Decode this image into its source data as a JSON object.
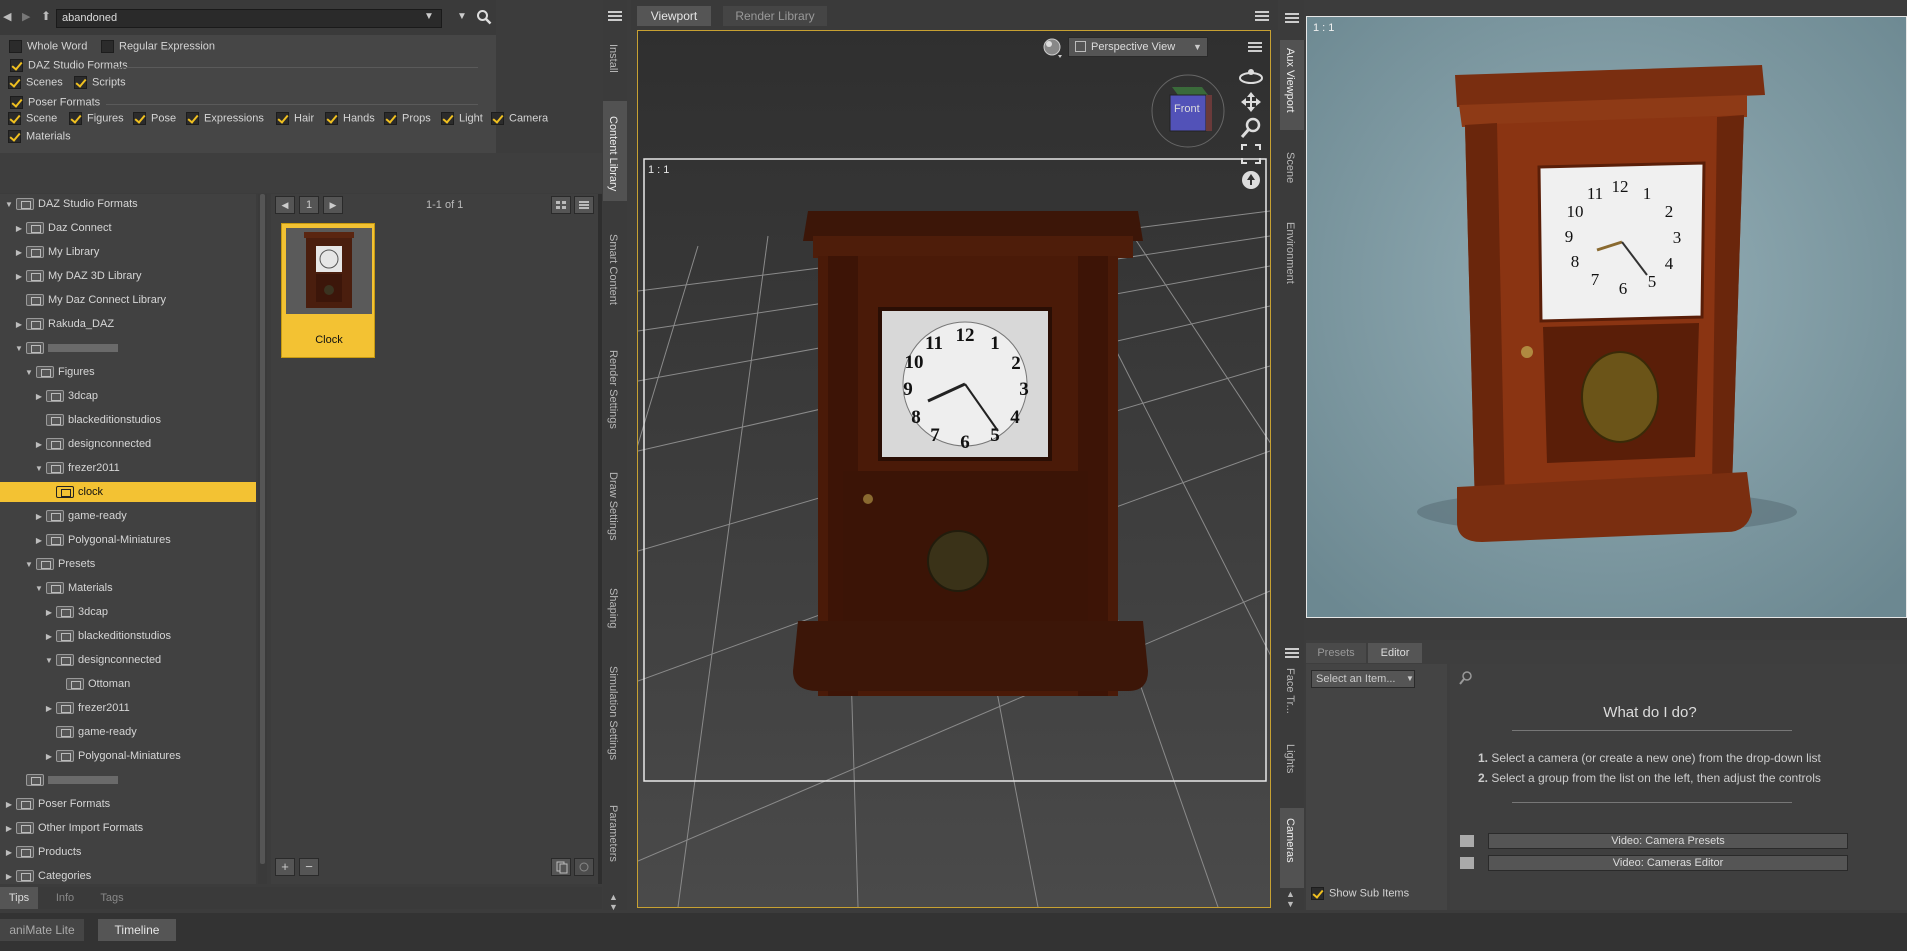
{
  "search": {
    "value": "abandoned"
  },
  "filters": {
    "whole_word": "Whole Word",
    "regex": "Regular Expression",
    "daz_formats": "DAZ Studio Formats",
    "scenes": "Scenes",
    "scripts": "Scripts",
    "poser_formats": "Poser Formats",
    "scene": "Scene",
    "figures": "Figures",
    "pose": "Pose",
    "expressions": "Expressions",
    "hair": "Hair",
    "hands": "Hands",
    "props": "Props",
    "light": "Light",
    "camera": "Camera",
    "materials": "Materials"
  },
  "tree": [
    {
      "label": "DAZ Studio Formats",
      "indent": 0,
      "arrow": "▼",
      "kind": "root"
    },
    {
      "label": "Daz Connect",
      "indent": 1,
      "arrow": "▶",
      "kind": "connect"
    },
    {
      "label": "My Library",
      "indent": 1,
      "arrow": "▶",
      "kind": "folder"
    },
    {
      "label": "My DAZ 3D Library",
      "indent": 1,
      "arrow": "▶",
      "kind": "folder"
    },
    {
      "label": "My Daz Connect Library",
      "indent": 1,
      "arrow": "",
      "kind": "folder"
    },
    {
      "label": "Rakuda_DAZ",
      "indent": 1,
      "arrow": "▶",
      "kind": "folder"
    },
    {
      "label": "",
      "indent": 1,
      "arrow": "▼",
      "kind": "blur"
    },
    {
      "label": "Figures",
      "indent": 2,
      "arrow": "▼",
      "kind": "folder"
    },
    {
      "label": "3dcap",
      "indent": 3,
      "arrow": "▶",
      "kind": "folder"
    },
    {
      "label": "blackeditionstudios",
      "indent": 3,
      "arrow": "",
      "kind": "folder"
    },
    {
      "label": "designconnected",
      "indent": 3,
      "arrow": "▶",
      "kind": "folder"
    },
    {
      "label": "frezer2011",
      "indent": 3,
      "arrow": "▼",
      "kind": "folder"
    },
    {
      "label": "clock",
      "indent": 4,
      "arrow": "",
      "kind": "folder",
      "selected": true
    },
    {
      "label": "game-ready",
      "indent": 3,
      "arrow": "▶",
      "kind": "folder"
    },
    {
      "label": "Polygonal-Miniatures",
      "indent": 3,
      "arrow": "▶",
      "kind": "folder"
    },
    {
      "label": "Presets",
      "indent": 2,
      "arrow": "▼",
      "kind": "folder"
    },
    {
      "label": "Materials",
      "indent": 3,
      "arrow": "▼",
      "kind": "folder"
    },
    {
      "label": "3dcap",
      "indent": 4,
      "arrow": "▶",
      "kind": "folder"
    },
    {
      "label": "blackeditionstudios",
      "indent": 4,
      "arrow": "▶",
      "kind": "folder"
    },
    {
      "label": "designconnected",
      "indent": 4,
      "arrow": "▼",
      "kind": "folder"
    },
    {
      "label": "Ottoman",
      "indent": 5,
      "arrow": "",
      "kind": "folder"
    },
    {
      "label": "frezer2011",
      "indent": 4,
      "arrow": "▶",
      "kind": "folder"
    },
    {
      "label": "game-ready",
      "indent": 4,
      "arrow": "",
      "kind": "folder"
    },
    {
      "label": "Polygonal-Miniatures",
      "indent": 4,
      "arrow": "▶",
      "kind": "folder"
    },
    {
      "label": "",
      "indent": 1,
      "arrow": "",
      "kind": "blur"
    },
    {
      "label": "Poser Formats",
      "indent": 0,
      "arrow": "▶",
      "kind": "root"
    },
    {
      "label": "Other Import Formats",
      "indent": 0,
      "arrow": "▶",
      "kind": "root"
    },
    {
      "label": "Products",
      "indent": 0,
      "arrow": "▶",
      "kind": "root"
    },
    {
      "label": "Categories",
      "indent": 0,
      "arrow": "▶",
      "kind": "root"
    }
  ],
  "content": {
    "page": "1",
    "count": "1-1 of 1",
    "item_label": "Clock"
  },
  "left_bottom_tabs": [
    "Tips",
    "Info",
    "Tags"
  ],
  "left_vtabs": [
    "Install",
    "Content Library",
    "Smart Content",
    "Render Settings",
    "Draw Settings",
    "Shaping",
    "Simulation Settings",
    "Parameters"
  ],
  "viewport": {
    "tabs": [
      "Viewport",
      "Render Library"
    ],
    "view_select": "Perspective View",
    "ratio": "1 : 1",
    "cube_label": "Front"
  },
  "aux": {
    "ratio": "1 : 1"
  },
  "right_vtabs_top": [
    "Aux Viewport",
    "Scene",
    "Environment"
  ],
  "right_vtabs_bottom": [
    "Face Tr...",
    "Lights",
    "Cameras"
  ],
  "editor": {
    "tabs": [
      "Presets",
      "Editor"
    ],
    "select": "Select an Item...",
    "title": "What do I do?",
    "step1": "Select a camera (or create a new one) from the drop-down list",
    "step2": "Select a group from the list on the left, then adjust the controls that",
    "video1": "Video: Camera Presets",
    "video2": "Video: Cameras Editor",
    "show_sub": "Show Sub Items"
  },
  "bottom_tabs": [
    "aniMate Lite",
    "Timeline"
  ],
  "colors": {
    "accent": "#f3c233",
    "sky": "#7e9aa4"
  }
}
